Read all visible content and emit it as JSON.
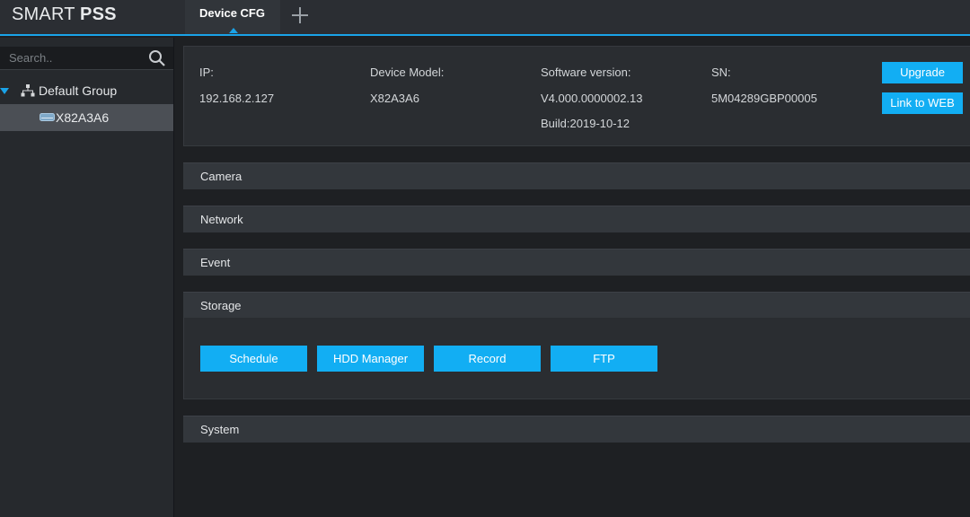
{
  "app": {
    "logo_light": "SMART ",
    "logo_bold": "PSS"
  },
  "tabs": [
    {
      "label": "Device CFG"
    }
  ],
  "sidebar": {
    "search_placeholder": "Search..",
    "group_label": "Default Group",
    "device_label": "X82A3A6"
  },
  "device_info": {
    "ip_label": "IP:",
    "ip_value": "192.168.2.127",
    "model_label": "Device Model:",
    "model_value": "X82A3A6",
    "software_label": "Software version:",
    "software_value": "V4.000.0000002.13",
    "build_value": "Build:2019-10-12",
    "sn_label": "SN:",
    "sn_value": "5M04289GBP00005",
    "upgrade_label": "Upgrade",
    "link_web_label": "Link to WEB"
  },
  "sections": {
    "camera": "Camera",
    "network": "Network",
    "event": "Event",
    "storage": "Storage",
    "system": "System"
  },
  "storage_buttons": {
    "schedule": "Schedule",
    "hdd_manager": "HDD Manager",
    "record": "Record",
    "ftp": "FTP"
  },
  "colors": {
    "accent": "#12aef3",
    "topbar": "#2b2e33",
    "background": "#1e2023"
  }
}
